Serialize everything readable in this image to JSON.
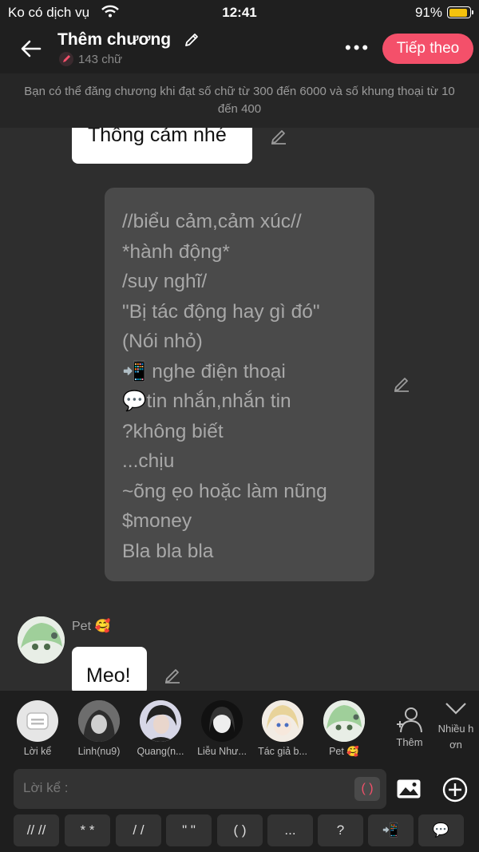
{
  "status": {
    "carrier": "Ko có dịch vụ",
    "time": "12:41",
    "battery": "91%",
    "battery_level": 0.91
  },
  "header": {
    "title": "Thêm chương",
    "word_count": "143 chữ",
    "next_label": "Tiếp theo",
    "accent": "#f4506a"
  },
  "notice": "Bạn có thể đăng chương khi đạt số chữ từ 300 đến 6000 và số khung thoại từ 10 đến 400",
  "chat": {
    "bubble1": "Thông cảm nhé",
    "narration": [
      "//biểu cảm,cảm xúc//",
      "*hành động*",
      "/suy nghĩ/",
      "\"Bị tác động hay gì đó\"",
      "(Nói nhỏ)",
      "📲 nghe điện thoại",
      "💬tin nhắn,nhắn tin",
      "?không biết",
      "...chịu",
      "~õng ẹo hoặc làm nũng",
      "$money",
      "Bla bla bla"
    ],
    "speaker": "Pet 🥰",
    "bubble2": "Meo!"
  },
  "characters": [
    {
      "label": "Lời kể",
      "icon": "narrator-icon"
    },
    {
      "label": "Linh(nu9)"
    },
    {
      "label": "Quang(n..."
    },
    {
      "label": "Liễu Như..."
    },
    {
      "label": "Tác giả b..."
    },
    {
      "label": "Pet 🥰"
    }
  ],
  "more_label": "Thêm",
  "multi_label": "Nhiều h ơn",
  "input": {
    "placeholder": "Lời kể :",
    "paren": "( )"
  },
  "keys": [
    "// //",
    "* *",
    "/ /",
    "\" \"",
    "( )",
    "...",
    "?",
    "📲",
    "💬"
  ]
}
